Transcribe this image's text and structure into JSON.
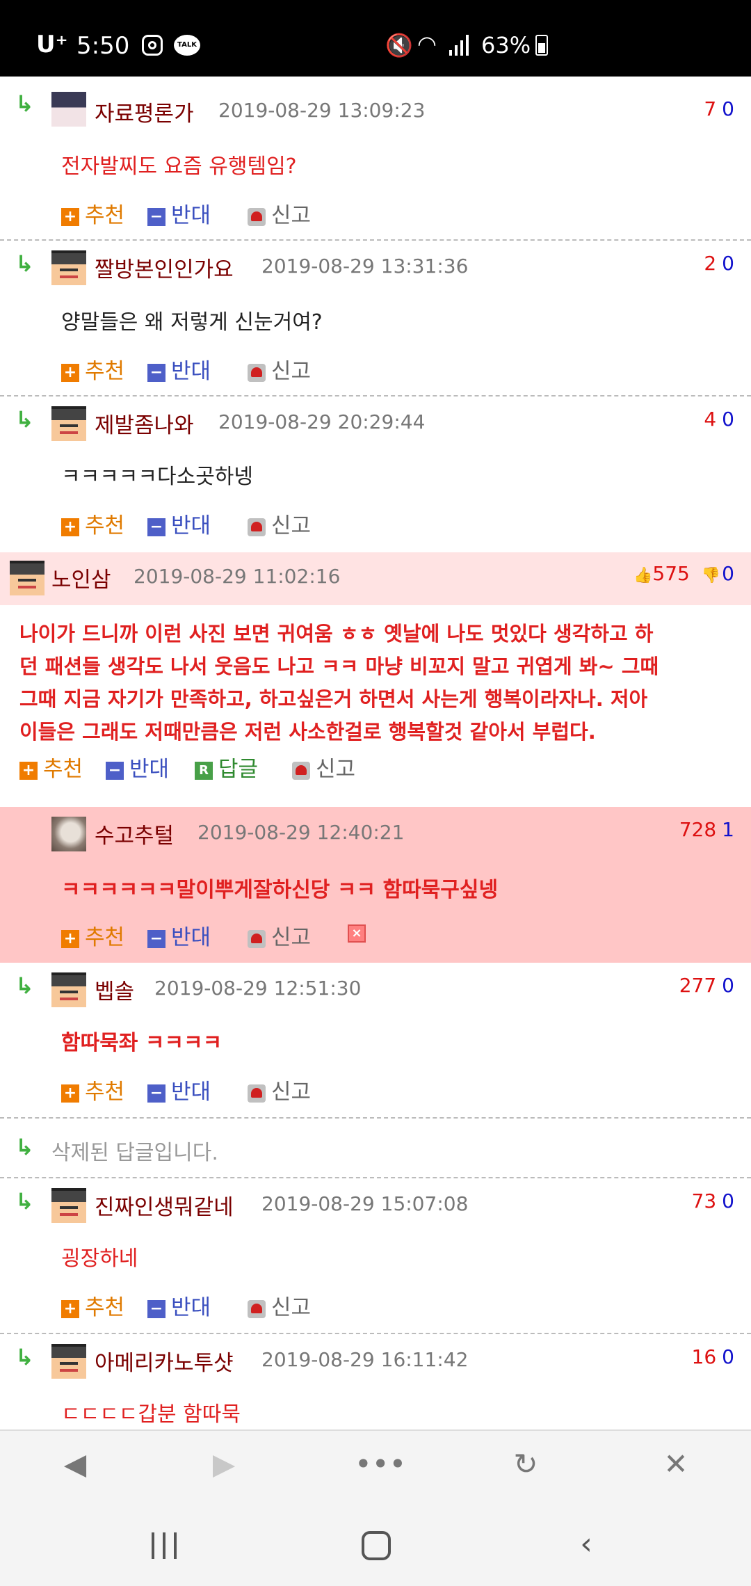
{
  "status_bar": {
    "carrier": "U⁺",
    "time": "5:50",
    "talk_label": "TALK",
    "battery": "63%"
  },
  "comments": [
    {
      "nick": "자료평론가",
      "date": "2019-08-29 13:09:23",
      "up": "7",
      "down": "0",
      "text": "전자발찌도 요즘 유행템임?"
    },
    {
      "nick": "짤방본인인가요",
      "date": "2019-08-29 13:31:36",
      "up": "2",
      "down": "0",
      "text": "양말들은 왜 저렇게 신눈거여?"
    },
    {
      "nick": "제발좀나와",
      "date": "2019-08-29 20:29:44",
      "up": "4",
      "down": "0",
      "text": "ㅋㅋㅋㅋㅋ다소곳하넹"
    },
    {
      "nick": "노인삼",
      "date": "2019-08-29 11:02:16",
      "up": "575",
      "down": "0",
      "text_lines": [
        "나이가 드니까 이런 사진 보면 귀여움 ㅎㅎ 옛날에 나도 멋있다 생각하고 하",
        "던 패션들 생각도 나서 웃음도 나고 ㅋㅋ 마냥 비꼬지 말고 귀엽게 봐~ 그때",
        "그때 지금 자기가 만족하고, 하고싶은거 하면서 사는게 행복이라자나. 저아",
        "이들은 그래도 저때만큼은 저런 사소한걸로 행복할것 같아서 부럽다."
      ]
    },
    {
      "nick": "수고추털",
      "date": "2019-08-29 12:40:21",
      "up": "728",
      "down": "1",
      "text": "ㅋㅋㅋㅋㅋㅋ말이뿌게잘하신당 ㅋㅋ 함따묵구싶넹"
    },
    {
      "nick": "벱솔",
      "date": "2019-08-29 12:51:30",
      "up": "277",
      "down": "0",
      "text": "함따묵좌 ㅋㅋㅋㅋ"
    },
    {
      "deleted_text": "삭제된 답글입니다."
    },
    {
      "nick": "진짜인생뭐같네",
      "date": "2019-08-29 15:07:08",
      "up": "73",
      "down": "0",
      "text": "굉장하네"
    },
    {
      "nick": "아메리카노투샷",
      "date": "2019-08-29 16:11:42",
      "up": "16",
      "down": "0",
      "text": "ㄷㄷㄷㄷ갑분 함따묵"
    }
  ],
  "actions": {
    "recommend": "추천",
    "oppose": "반대",
    "reply": "답글",
    "report": "신고",
    "reply_icon_letter": "R"
  },
  "icons": {
    "reply_arrow": "↳",
    "thumb_up": "👍",
    "thumb_down": "👎"
  },
  "colors": {
    "nick": "#7a0000",
    "red_text": "#e02020",
    "up_vote": "#dd1111",
    "down_vote": "#1111cc",
    "highlight_bg": "#ffe3e3",
    "best_bg": "#ffc6c6"
  }
}
